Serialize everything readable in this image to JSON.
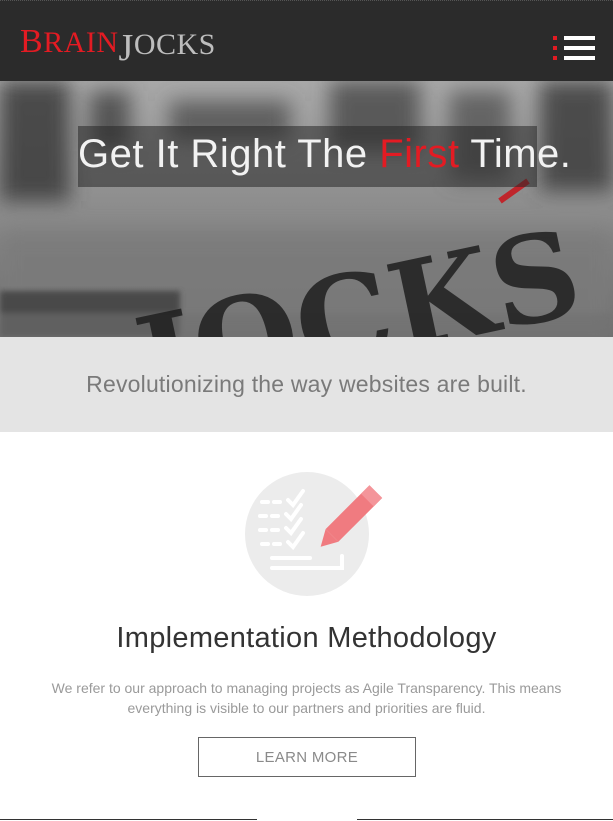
{
  "header": {
    "logo_brain": "BRAIN",
    "logo_jocks": "JOCKS"
  },
  "hero": {
    "title_before": "Get It Right The ",
    "title_accent": "First",
    "title_after": " Time.",
    "accent_color": "#e31b23"
  },
  "tagline": {
    "text": "Revolutionizing the way websites are built."
  },
  "section": {
    "icon": "checklist-pencil-icon",
    "title": "Implementation Methodology",
    "description": "We refer to our approach to managing projects as Agile Transparency. This means everything is visible to our partners and priorities are fluid.",
    "button_label": "LEARN MORE"
  },
  "colors": {
    "brand_red": "#e31b23",
    "header_bg": "#2b2b2b",
    "tagline_bg": "#e4e4e4"
  }
}
